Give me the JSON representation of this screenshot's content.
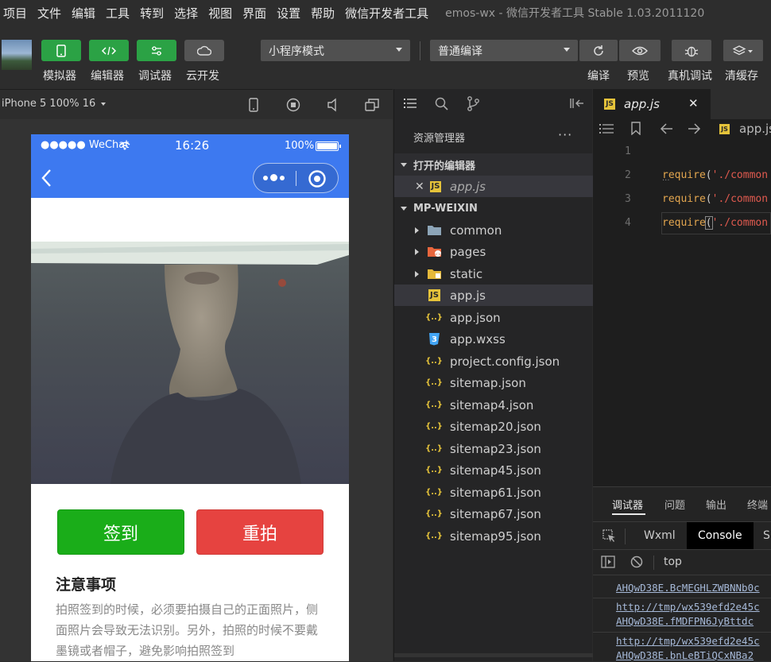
{
  "menubar": {
    "items": [
      "项目",
      "文件",
      "编辑",
      "工具",
      "转到",
      "选择",
      "视图",
      "界面",
      "设置",
      "帮助",
      "微信开发者工具"
    ],
    "window_title": "emos-wx - 微信开发者工具 Stable 1.03.2011120"
  },
  "toolbar": {
    "simulator_label": "模拟器",
    "editor_label": "编辑器",
    "debugger_label": "调试器",
    "cloud_label": "云开发",
    "mode_select": "小程序模式",
    "compile_select": "普通编译",
    "compile_label": "编译",
    "preview_label": "预览",
    "remote_debug_label": "真机调试",
    "clear_cache_label": "清缓存"
  },
  "simulator": {
    "device_select": "iPhone 5 100% 16"
  },
  "phone": {
    "carrier": "●●●●● WeChat",
    "time": "16:26",
    "battery": "100%",
    "signin_button": "签到",
    "retake_button": "重拍",
    "notice_title": "注意事项",
    "notice_text": "拍照签到的时候，必须要拍摄自己的正面照片，侧面照片会导致无法识别。另外，拍照的时候不要戴墨镜或者帽子，避免影响拍照签到"
  },
  "explorer": {
    "title": "资源管理器",
    "more": "···",
    "open_editors": "打开的编辑器",
    "open_file": "app.js",
    "project": "MP-WEIXIN",
    "folders": [
      "common",
      "pages",
      "static"
    ],
    "files": [
      "app.js",
      "app.json",
      "app.wxss",
      "project.config.json",
      "sitemap.json",
      "sitemap4.json",
      "sitemap20.json",
      "sitemap23.json",
      "sitemap45.json",
      "sitemap61.json",
      "sitemap67.json",
      "sitemap95.json"
    ],
    "icon_colors": {
      "folder": "#8da5b8",
      "pages": "#e8663d",
      "static": "#e5b93a",
      "js": "#e5c33a",
      "json": "#e5c33a",
      "wxss": "#42a5f5"
    }
  },
  "editor": {
    "tab_label": "app.js",
    "close": "✕",
    "breadcrumb": "app.js",
    "lines": [
      {
        "no": "1",
        "kw": "",
        "open": "",
        "str": ""
      },
      {
        "no": "2",
        "kw": "require",
        "open": "(",
        "str": "'./common"
      },
      {
        "no": "3",
        "kw": "require",
        "open": "(",
        "str": "'./common"
      },
      {
        "no": "4",
        "kw": "require",
        "open": "(",
        "str": "'./common"
      }
    ]
  },
  "devtools": {
    "tabs": [
      "调试器",
      "问题",
      "输出",
      "终端"
    ],
    "panel_tabs": [
      "Wxml",
      "Console",
      "S"
    ],
    "context": "top",
    "logs": [
      "AHQwD38E.BcMEGHLZWBNNb0c",
      "http://tmp/wx539efd2e45c",
      "AHQwD38E.fMDFPN6JyBttdc",
      "http://tmp/wx539efd2e45c",
      "AHQwD38E.bnLeBTiQCxNBa2"
    ]
  }
}
